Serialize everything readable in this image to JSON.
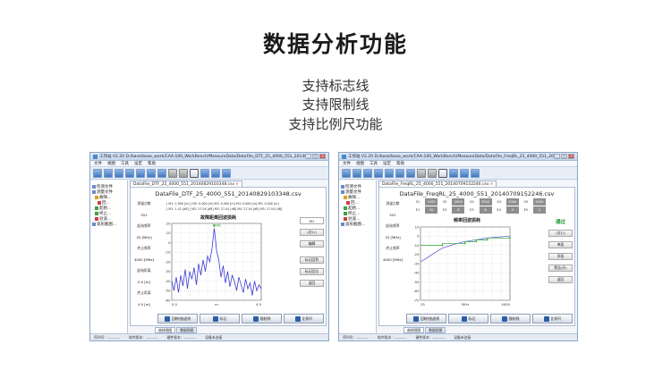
{
  "page": {
    "title": "数据分析功能",
    "features": [
      "支持标志线",
      "支持限制线",
      "支持比例尺功能"
    ]
  },
  "colors": {
    "accent": "#2b5ea7",
    "trace": "#3b3bd6",
    "limit": "#26a832",
    "pass": "#1c9a2c"
  },
  "menu": [
    "文件",
    "视图",
    "工具",
    "设定",
    "帮助"
  ],
  "tree": [
    {
      "label": "检测文件",
      "level": 0,
      "color": "#6b8cc4"
    },
    {
      "label": "测量文件",
      "level": 0,
      "color": "#6b8cc4"
    },
    {
      "label": "故障...",
      "level": 1,
      "color": "#e0a020"
    },
    {
      "label": "回...",
      "level": 2,
      "color": "#d04040"
    },
    {
      "label": "起始...",
      "level": 1,
      "color": "#40a040"
    },
    {
      "label": "终止...",
      "level": 1,
      "color": "#40a040"
    },
    {
      "label": "驻波...",
      "level": 1,
      "color": "#d04040"
    },
    {
      "label": "波形截图...",
      "level": 0,
      "color": "#6b8cc4"
    }
  ],
  "left_window": {
    "title": "工作站 V2.20  D:/base/base_work/CAA-100_WorkBench/MeasureData/DataFile_DTF_25_4000_551_20140829103348.csv",
    "doc_tab": "DataFile_DTF_25_4000_551_20140829103348.csv",
    "file_title": "DataFile_DTF_25_4000_551_20140829103348.csv",
    "params": [
      "测量点数",
      "551",
      "起始频率",
      "25 [MHz]",
      "终止频率",
      "4000 [MHz]",
      "起始距离",
      "0.0 [m]",
      "终止距离",
      "4.0 [m]"
    ],
    "markers": [
      "[ M1: 1.900 [m] ]  M2: 0.000 [m]  M3: 0.000 [m]  M4: 0.000 [m]  M5: 0.000 [m]",
      "[ M1: 1.42 [dB] ]  M2: 27.04 [dB]  M3: 27.04 [dB]  M4: 27.04 [dB]  M5: 27.04 [dB]"
    ],
    "chart_title": "故障距离回波损耗",
    "side_buttons": [
      "M1",
      "(次1/)",
      "编辑",
      "标记回到",
      "标记回位",
      "返回"
    ],
    "bottom_buttons": [
      "回映/放虚线",
      "标记",
      "限制线",
      "比例尺"
    ],
    "status": [
      "序列号：----------",
      "软件版本：----------",
      "硬件版本：----------",
      "设备未连接"
    ]
  },
  "right_window": {
    "title": "工作站 V2.20  D:/base/base_work/CAA-100_WorkBench/MeasureData/DataFile_FreqRL_25_4000_551_20140709152246.csv",
    "doc_tab": "DataFile_FreqRL_25_4000_551_20140709152246.csv",
    "file_title": "DataFile_FreqRL_25_4000_551_20140709152246.csv",
    "params": [
      "测量点数",
      "551",
      "起始频率",
      "25 [MHz]",
      "终止频率",
      "4000 [MHz]"
    ],
    "grid_row1": [
      "S1",
      "1000",
      "S2",
      "2000",
      "S3",
      "2500",
      "S4",
      "3000",
      "S5",
      "4000"
    ],
    "grid_row2": [
      "E1",
      "10",
      "E2",
      "8",
      "E3",
      "6",
      "E4",
      "4",
      "E5",
      "2"
    ],
    "chart_title": "频率回波损耗",
    "pass_label": "通过",
    "side_buttons": [
      "(次1/)",
      "单段",
      "多段",
      "警告(开)",
      "返回"
    ],
    "bottom_buttons": [
      "回映/放虚线",
      "标记",
      "限制线",
      "比例尺"
    ],
    "status": [
      "序列号：----------",
      "软件版本：----------",
      "硬件版本：----------",
      "设备未连接"
    ]
  },
  "sub_tabs": [
    "曲线视图",
    "数据视图"
  ],
  "chart_data": [
    {
      "type": "line",
      "title": "故障距离回波损耗",
      "xlabel": "m",
      "x_ticks": [
        "0.0",
        "m",
        "4.0"
      ],
      "y_ticks": [
        "20",
        "10",
        "0",
        "-10",
        "-20",
        "-30",
        "-40",
        "-50",
        "-60"
      ],
      "xlim": [
        0,
        4
      ],
      "ylim": [
        -60,
        20
      ],
      "x": [
        0.0,
        0.1,
        0.2,
        0.3,
        0.4,
        0.5,
        0.6,
        0.7,
        0.8,
        0.9,
        1.0,
        1.1,
        1.2,
        1.3,
        1.4,
        1.5,
        1.6,
        1.7,
        1.8,
        1.85,
        1.9,
        1.95,
        2.0,
        2.1,
        2.2,
        2.3,
        2.4,
        2.5,
        2.6,
        2.7,
        2.8,
        2.9,
        3.0,
        3.1,
        3.2,
        3.3,
        3.4,
        3.5,
        3.6,
        3.7,
        3.8,
        3.9,
        4.0
      ],
      "y": [
        -40,
        -50,
        -36,
        -52,
        -34,
        -45,
        -28,
        -48,
        -30,
        -38,
        -26,
        -44,
        -22,
        -34,
        -18,
        -30,
        -14,
        -20,
        -6,
        5,
        15,
        4,
        -8,
        -18,
        -36,
        -24,
        -42,
        -30,
        -46,
        -34,
        -40,
        -50,
        -36,
        -44,
        -52,
        -38,
        -48,
        -42,
        -55,
        -40,
        -50,
        -44,
        -48
      ],
      "markers": [
        {
          "name": "M1",
          "x": 1.9,
          "y": 15
        }
      ]
    },
    {
      "type": "line",
      "title": "频率回波损耗",
      "xlabel": "MHz",
      "x_ticks": [
        "25",
        "MHz",
        "4000"
      ],
      "y_ticks": [
        "10",
        "0",
        "-10",
        "-20",
        "-30",
        "-40",
        "-50",
        "-60",
        "-70"
      ],
      "xlim": [
        25,
        4000
      ],
      "ylim": [
        -70,
        10
      ],
      "series": [
        {
          "x": [
            25,
            300,
            600,
            1000,
            1500,
            2000,
            2500,
            3000,
            3500,
            4000
          ],
          "y": [
            -28,
            -24,
            -19,
            -13,
            -9,
            -6,
            -4,
            -2,
            -1,
            0
          ]
        },
        {
          "x": [
            25,
            1000,
            1000,
            2000,
            2000,
            2500,
            2500,
            3000,
            3000,
            4000
          ],
          "y": [
            -10,
            -10,
            -8,
            -8,
            -6,
            -6,
            -4,
            -4,
            -2,
            -2
          ]
        }
      ]
    }
  ]
}
